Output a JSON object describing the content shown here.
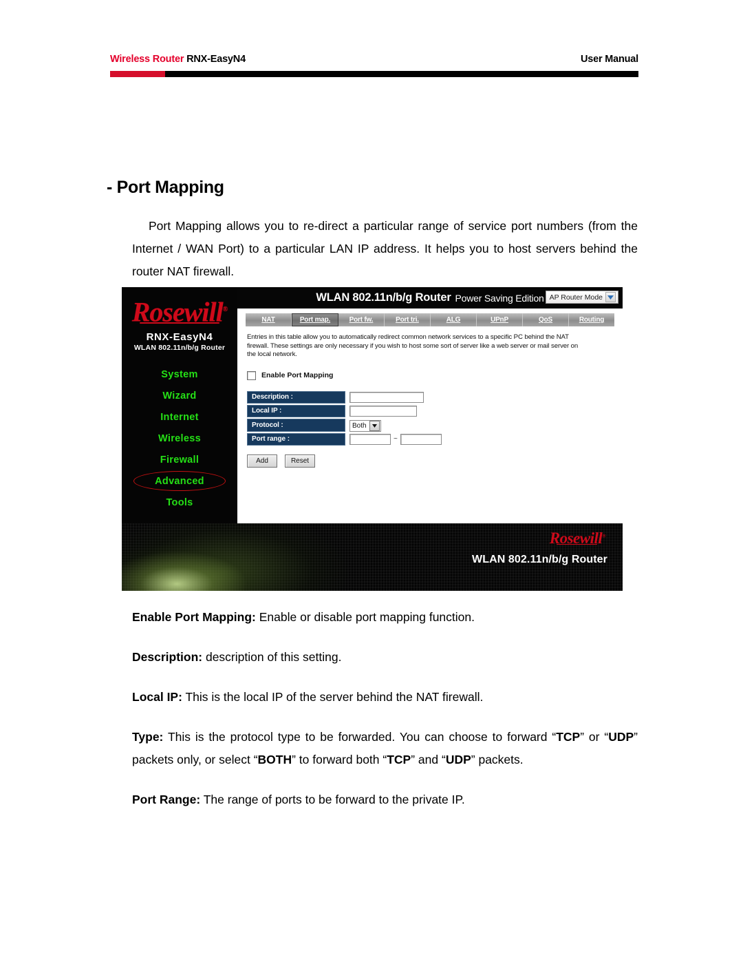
{
  "header": {
    "brand": "Wireless Router",
    "model": " RNX-EasyN4",
    "doc_type": "User Manual"
  },
  "section": {
    "title": "- Port Mapping",
    "intro": "Port Mapping allows you to re-direct a particular range of service port numbers (from the Internet / WAN Port) to a particular LAN IP address. It helps you to host servers behind the router NAT firewall."
  },
  "router_ui": {
    "sidebar": {
      "logo_text": "Rosewill",
      "logo_reg": "®",
      "model": "RNX-EasyN4",
      "submodel": "WLAN 802.11n/b/g Router",
      "menu": [
        {
          "label": "System",
          "circled": false
        },
        {
          "label": "Wizard",
          "circled": false
        },
        {
          "label": "Internet",
          "circled": false
        },
        {
          "label": "Wireless",
          "circled": false
        },
        {
          "label": "Firewall",
          "circled": false
        },
        {
          "label": "Advanced",
          "circled": true
        },
        {
          "label": "Tools",
          "circled": false
        }
      ]
    },
    "topbar": {
      "title": "WLAN 802.11n/b/g Router",
      "subtitle": "Power Saving Edition",
      "mode_value": "AP Router Mode"
    },
    "tabs": [
      {
        "label": "NAT",
        "active": false
      },
      {
        "label": "Port map.",
        "active": true
      },
      {
        "label": "Port fw.",
        "active": false
      },
      {
        "label": "Port tri.",
        "active": false
      },
      {
        "label": "ALG",
        "active": false
      },
      {
        "label": "UPnP",
        "active": false
      },
      {
        "label": "QoS",
        "active": false
      },
      {
        "label": "Routing",
        "active": false
      }
    ],
    "description": "Entries in this table allow you to automatically redirect common network services to a specific PC behind the NAT firewall. These settings are only necessary if you wish to host some sort of server like a web server or mail server on the local network.",
    "enable_label": "Enable Port Mapping",
    "enable_checked": false,
    "form": {
      "rows": [
        {
          "label": "Description :",
          "value": ""
        },
        {
          "label": "Local IP :",
          "value": ""
        },
        {
          "label": "Protocol :",
          "value": "Both"
        },
        {
          "label": "Port range :",
          "value": ""
        }
      ],
      "range_separator": "~",
      "protocol_value": "Both"
    },
    "buttons": {
      "add": "Add",
      "reset": "Reset"
    },
    "banner": {
      "logo_text": "Rosewill",
      "logo_reg": "®",
      "text": "WLAN 802.11n/b/g Router"
    }
  },
  "descriptions": [
    {
      "term": "Enable Port Mapping:",
      "text": " Enable or disable port mapping function."
    },
    {
      "term": "Description:",
      "text": " description of this setting."
    },
    {
      "term": "Local IP:",
      "text": " This is the local IP of the server behind the NAT firewall."
    },
    {
      "term": "Type:",
      "text": " This is the protocol type to be forwarded. You can choose to forward “TCP” or “UDP” packets only, or select “BOTH” to forward both “TCP” and “UDP” packets."
    },
    {
      "term": "Port Range:",
      "text": " The range of ports to be forward to the private IP."
    }
  ],
  "colors": {
    "brand_red": "#e4002b",
    "rule_red": "#d50f2b",
    "menu_green": "#25e016",
    "form_label_navy": "#16395d",
    "annotation_red": "#c41111"
  }
}
